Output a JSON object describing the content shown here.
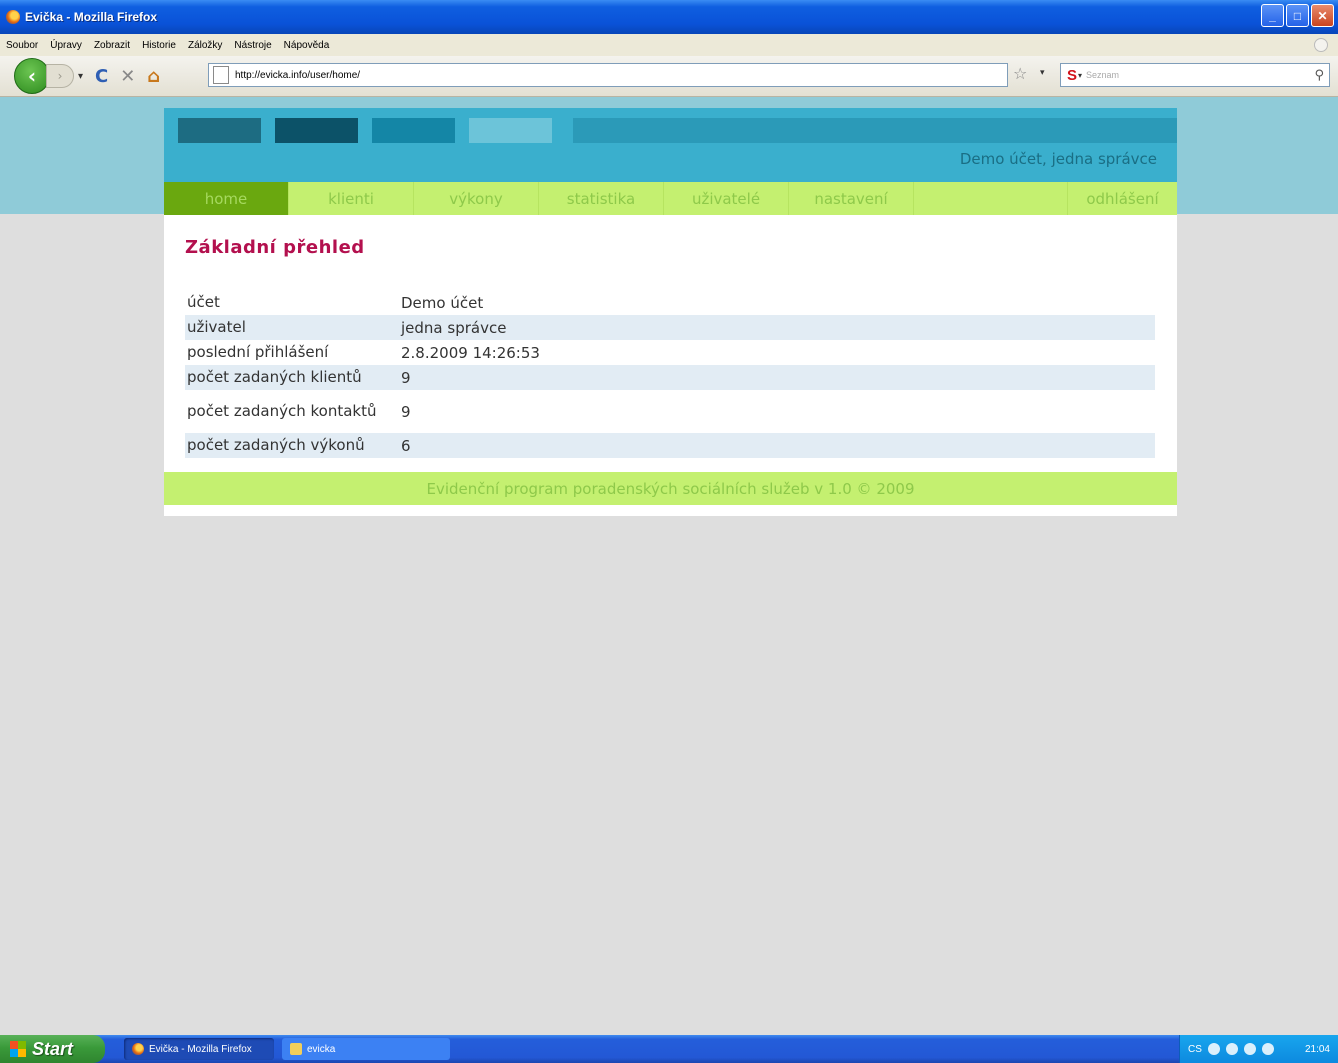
{
  "window": {
    "title": "Evička - Mozilla Firefox",
    "buttons": {
      "minimize": "_",
      "maximize": "□",
      "close": "✕"
    }
  },
  "menubar": [
    "Soubor",
    "Úpravy",
    "Zobrazit",
    "Historie",
    "Záložky",
    "Nástroje",
    "Nápověda"
  ],
  "navbar": {
    "url": "http://evicka.info/user/home/",
    "search_placeholder": "Seznam",
    "search_logo": "S"
  },
  "page": {
    "user_info": "Demo účet, jedna správce",
    "menu": [
      {
        "label": "home",
        "active": true
      },
      {
        "label": "klienti"
      },
      {
        "label": "výkony"
      },
      {
        "label": "statistika"
      },
      {
        "label": "uživatelé"
      },
      {
        "label": "nastavení"
      }
    ],
    "logout": "odhlášení",
    "heading": "Základní přehled",
    "rows": [
      {
        "key": "účet",
        "value": "Demo účet"
      },
      {
        "key": "uživatel",
        "value": "jedna správce"
      },
      {
        "key": "poslední přihlášení",
        "value": "2.8.2009 14:26:53"
      },
      {
        "key": "počet zadaných klientů",
        "value": "9"
      },
      {
        "key": "počet zadaných kontaktů",
        "value": "9"
      },
      {
        "key": "počet zadaných výkonů",
        "value": "6"
      }
    ],
    "footer": "Evidenční program poradenských sociálních služeb v 1.0 © 2009"
  },
  "taskbar": {
    "start": "Start",
    "items": [
      "Evička - Mozilla Firefox",
      "evicka"
    ],
    "lang": "CS",
    "clock": "21:04"
  }
}
